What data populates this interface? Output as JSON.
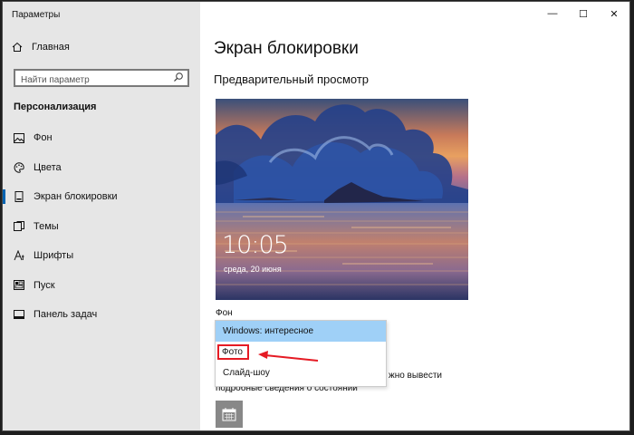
{
  "window": {
    "title": "Параметры",
    "controls": {
      "minimize": "—",
      "maximize": "☐",
      "close": "✕"
    }
  },
  "sidebar": {
    "home_label": "Главная",
    "search_placeholder": "Найти параметр",
    "section_title": "Персонализация",
    "items": [
      {
        "label": "Фон",
        "icon": "picture-icon"
      },
      {
        "label": "Цвета",
        "icon": "palette-icon"
      },
      {
        "label": "Экран блокировки",
        "icon": "lock-screen-icon",
        "active": true
      },
      {
        "label": "Темы",
        "icon": "themes-icon"
      },
      {
        "label": "Шрифты",
        "icon": "fonts-icon"
      },
      {
        "label": "Пуск",
        "icon": "start-icon"
      },
      {
        "label": "Панель задач",
        "icon": "taskbar-icon"
      }
    ]
  },
  "main": {
    "title": "Экран блокировки",
    "preview_title": "Предварительный просмотр",
    "preview": {
      "time": "10:05",
      "date": "среда, 20 июня"
    },
    "background_label": "Фон",
    "dropdown_options": [
      "Windows: интересное",
      "Фото",
      "Слайд-шоу"
    ],
    "selected_option": "Windows: интересное",
    "highlighted_option": "Фото",
    "hint_partial_right": "жно вывести",
    "hint_line2": "подробные сведения о состоянии",
    "app_icon": "calendar-icon"
  },
  "colors": {
    "accent": "#0063b1",
    "selected_option": "#9fd0f7",
    "annotation_red": "#e51b24",
    "sidebar_bg": "#e6e6e6"
  }
}
